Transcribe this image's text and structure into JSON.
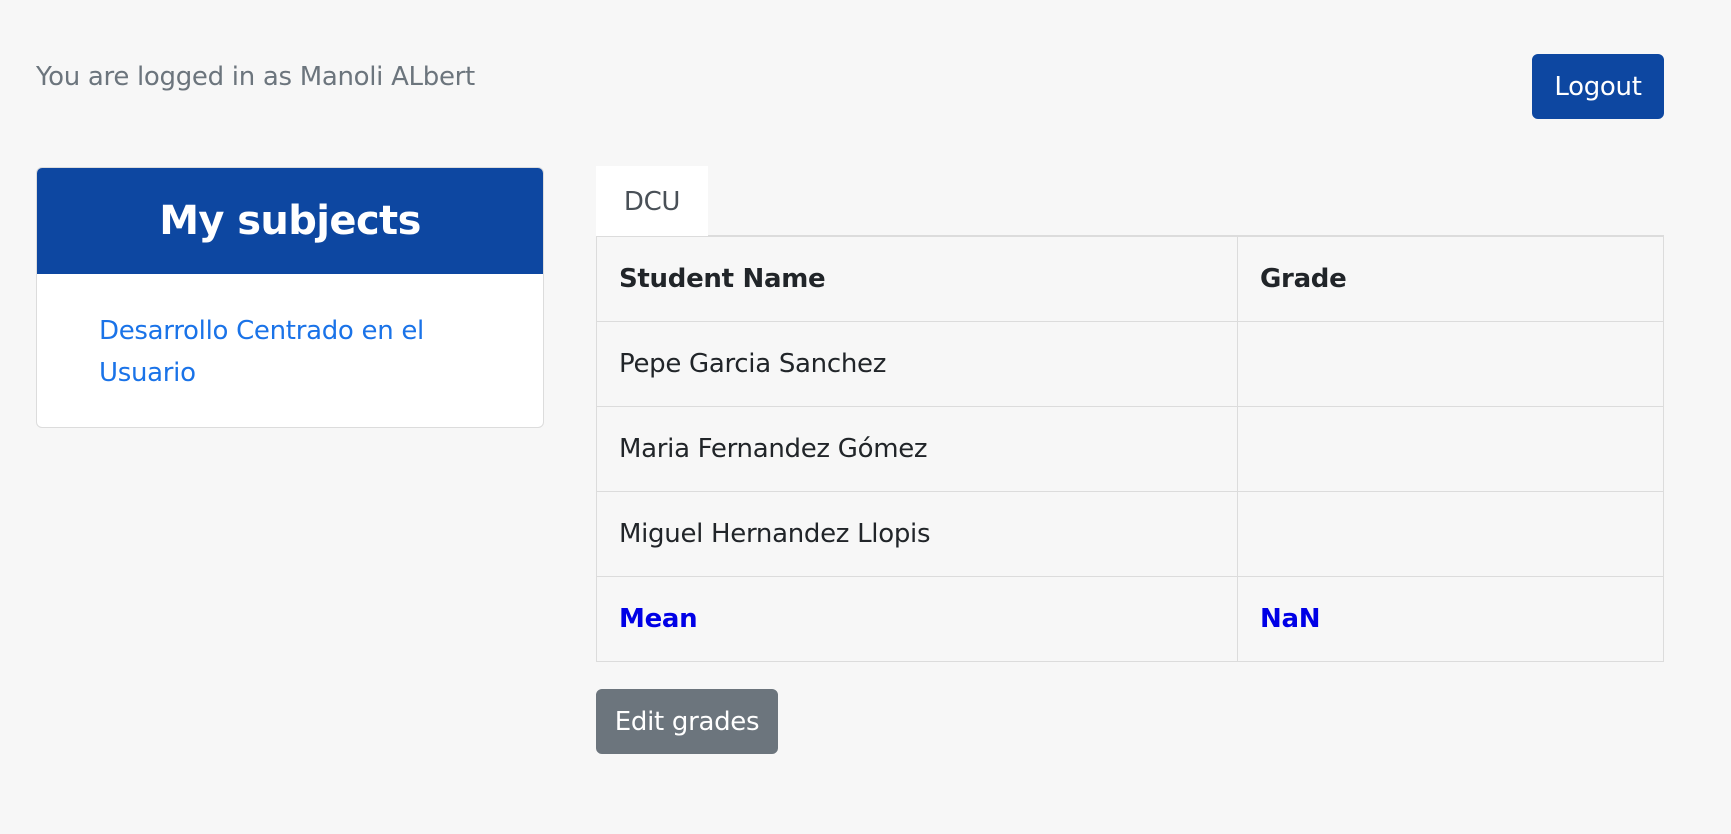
{
  "header": {
    "login_status": "You are logged in as Manoli ALbert",
    "logout_label": "Logout"
  },
  "sidebar": {
    "title": "My subjects",
    "subjects": [
      {
        "label": "Desarrollo Centrado en el Usuario"
      }
    ]
  },
  "main": {
    "tabs": [
      {
        "label": "DCU"
      }
    ],
    "table": {
      "headers": [
        "Student Name",
        "Grade"
      ],
      "rows": [
        {
          "name": "Pepe Garcia Sanchez",
          "grade": ""
        },
        {
          "name": "Maria Fernandez Gómez",
          "grade": ""
        },
        {
          "name": "Miguel Hernandez Llopis",
          "grade": ""
        }
      ],
      "mean_label": "Mean",
      "mean_value": "NaN"
    },
    "edit_grades_label": "Edit grades"
  },
  "colors": {
    "brand": "#0d47a1",
    "link": "#1a73e8",
    "mean": "#0000e6",
    "secondary_button": "#6c757d",
    "background": "#f7f7f7"
  }
}
